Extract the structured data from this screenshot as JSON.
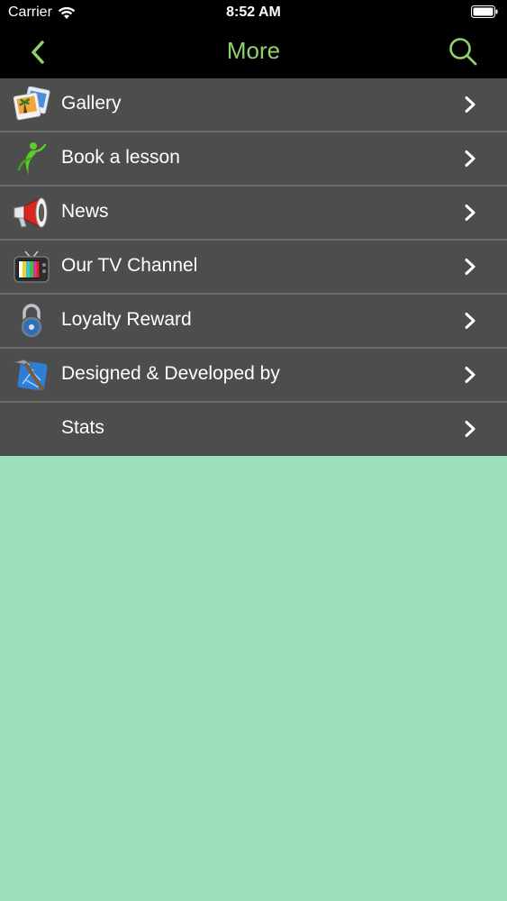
{
  "status_bar": {
    "carrier": "Carrier",
    "time": "8:52 AM"
  },
  "nav": {
    "title": "More",
    "back_icon": "chevron-left-icon",
    "search_icon": "search-icon",
    "accent_color": "#8fd16a"
  },
  "menu": {
    "items": [
      {
        "label": "Gallery",
        "icon": "gallery-icon"
      },
      {
        "label": "Book a lesson",
        "icon": "golfer-icon"
      },
      {
        "label": "News",
        "icon": "megaphone-icon"
      },
      {
        "label": "Our TV Channel",
        "icon": "tv-icon"
      },
      {
        "label": "Loyalty Reward",
        "icon": "padlock-icon"
      },
      {
        "label": "Designed & Developed by",
        "icon": "developer-tools-icon"
      },
      {
        "label": "Stats",
        "icon": ""
      }
    ]
  },
  "colors": {
    "background": "#9ee0bc",
    "row_background": "#4d4d4d",
    "row_divider": "#6a6a6a"
  }
}
